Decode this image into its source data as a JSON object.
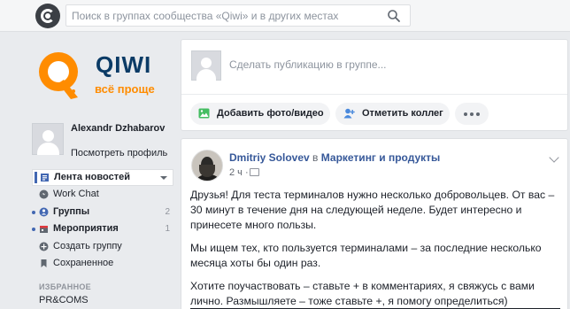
{
  "topbar": {
    "search_placeholder": "Поиск в группах сообщества «Qiwi» и в других местах"
  },
  "brand": {
    "name": "QIWI",
    "slogan": "всё проще",
    "colors": {
      "orange": "#ff8c00",
      "navy": "#0b3b66"
    }
  },
  "profile": {
    "name": "Alexandr Dzhabarov",
    "view_link": "Посмотреть профиль"
  },
  "nav": {
    "items": [
      {
        "label": "Лента новостей",
        "active": true,
        "icon": "news-feed-icon"
      },
      {
        "label": "Work Chat",
        "icon": "chat-icon"
      },
      {
        "label": "Группы",
        "count": "2",
        "icon": "groups-icon",
        "bold": true
      },
      {
        "label": "Мероприятия",
        "count": "1",
        "icon": "calendar-icon",
        "bold": true
      },
      {
        "label": "Создать группу",
        "icon": "plus-icon"
      },
      {
        "label": "Сохраненное",
        "icon": "bookmark-icon"
      }
    ],
    "favorites_header": "ИЗБРАННОЕ",
    "favorites": [
      "PR&COMS"
    ]
  },
  "composer": {
    "placeholder": "Сделать публикацию в группе...",
    "add_photo": "Добавить фото/видео",
    "tag_colleagues": "Отметить коллег"
  },
  "post": {
    "author": "Dmitriy Solovev",
    "in_word": "в",
    "group": "Маркетинг и продукты",
    "time": "2 ч ·",
    "paragraphs": [
      "Друзья! Для теста терминалов нужно несколько добровольцев. От вас – 30 минут в течение дня на следующей неделе. Будет интересно и принесете много пользы.",
      "Мы ищем тех, кто пользуется терминалами – за последние несколько месяца хоты бы один раз.",
      "Хотите поучаствовать – ставьте + в комментариях, я свяжусь с вами лично. Размышляете – тоже ставьте +, я помогу определиться)"
    ]
  },
  "colors": {
    "link": "#365899",
    "accent": "#4267b2",
    "background": "#e9ebee"
  }
}
